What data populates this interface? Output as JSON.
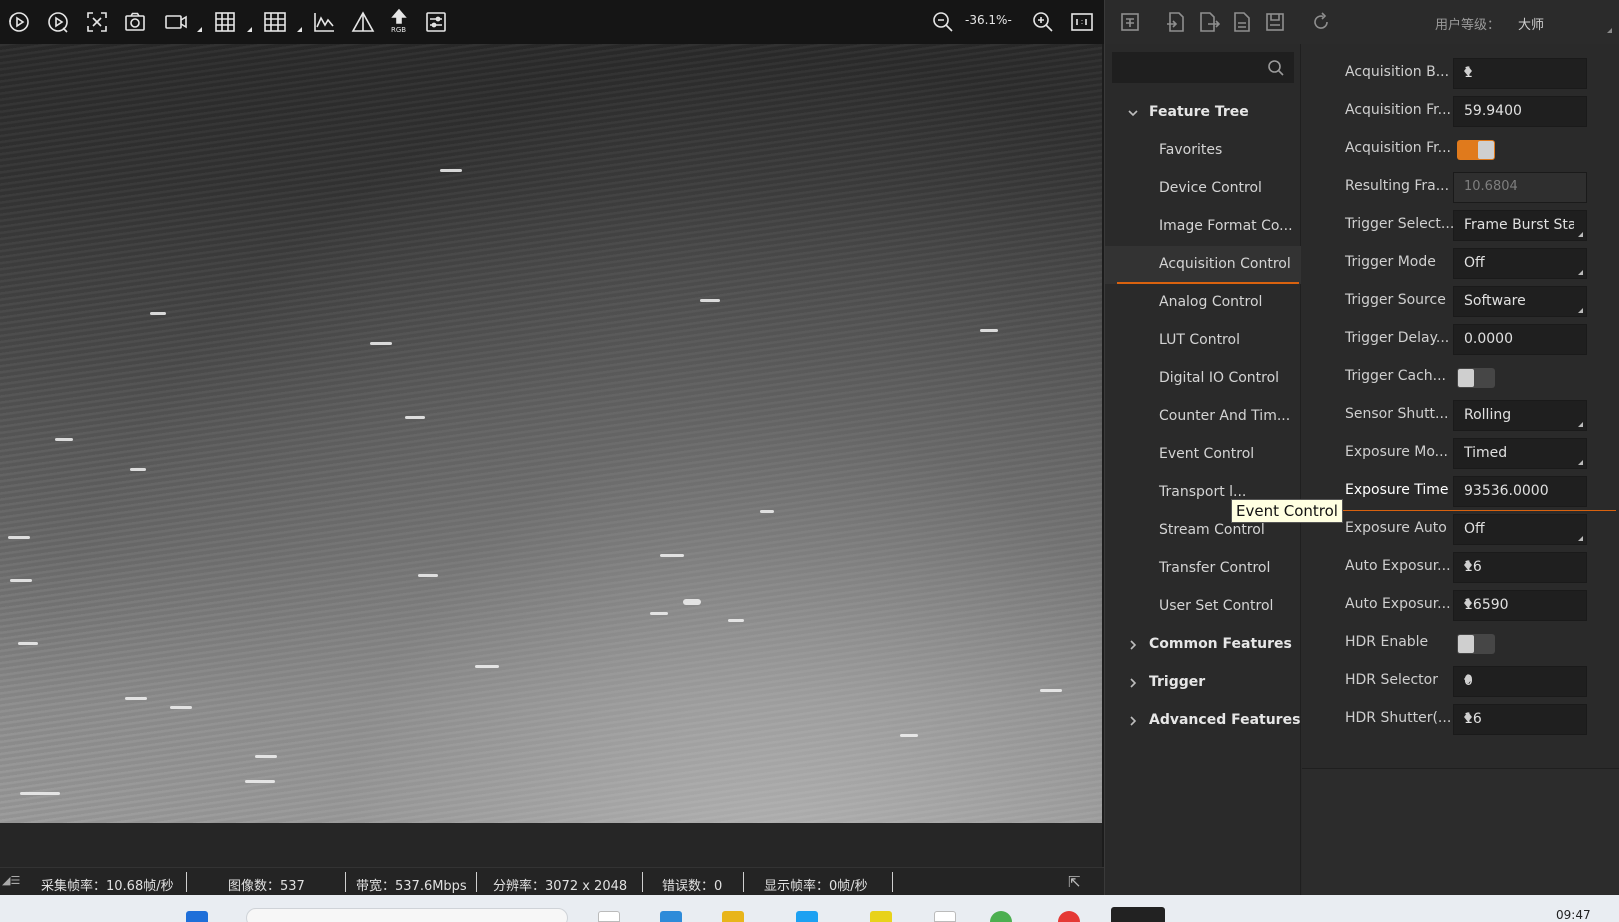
{
  "viewer": {
    "zoom_level": "-36.1%-",
    "rgb_label": "RGB",
    "toolbar_icons": [
      "continuous-capture-icon",
      "single-capture-icon",
      "stop-capture-icon",
      "snapshot-icon",
      "record-icon",
      "grid-layout-icon",
      "grid-icon",
      "histogram-icon",
      "warning-icon",
      "rgb-icon",
      "settings-icon",
      "zoom-out-icon",
      "zoom-in-icon",
      "actual-size-icon"
    ]
  },
  "statusbar": {
    "acq_rate": "采集帧率：10.68帧/秒",
    "image_count": "图像数：537",
    "bandwidth": "带宽：537.6Mbps",
    "resolution": "分辨率：3072 x 2048",
    "errors": "错误数：0",
    "display_rate": "显示帧率：0帧/秒"
  },
  "right_toolbar": {
    "user_level_label": "用户等级：",
    "user_level_value": "大师"
  },
  "tree": {
    "search_placeholder": "",
    "items": [
      {
        "label": "Feature Tree",
        "level": "top",
        "expanded": true
      },
      {
        "label": "Favorites",
        "level": "child"
      },
      {
        "label": "Device Control",
        "level": "child"
      },
      {
        "label": "Image Format Co...",
        "level": "child"
      },
      {
        "label": "Acquisition Control",
        "level": "child",
        "selected": true
      },
      {
        "label": "Analog Control",
        "level": "child"
      },
      {
        "label": "LUT Control",
        "level": "child"
      },
      {
        "label": "Digital IO Control",
        "level": "child"
      },
      {
        "label": "Counter And Tim...",
        "level": "child"
      },
      {
        "label": "Event Control",
        "level": "child"
      },
      {
        "label": "Transport l...",
        "level": "child"
      },
      {
        "label": "Stream Control",
        "level": "child"
      },
      {
        "label": "Transfer Control",
        "level": "child"
      },
      {
        "label": "User Set Control",
        "level": "child"
      },
      {
        "label": "Common Features",
        "level": "top",
        "expanded": false
      },
      {
        "label": "Trigger",
        "level": "top",
        "expanded": false
      },
      {
        "label": "Advanced Features",
        "level": "top",
        "expanded": false
      }
    ]
  },
  "properties": [
    {
      "label": "Acquisition B...",
      "type": "spin",
      "value": "1"
    },
    {
      "label": "Acquisition Fr...",
      "type": "text",
      "value": "59.9400"
    },
    {
      "label": "Acquisition Fr...",
      "type": "toggle",
      "on": true
    },
    {
      "label": "Resulting Fra...",
      "type": "readonly",
      "value": "10.6804"
    },
    {
      "label": "Trigger Select...",
      "type": "dropdown",
      "value": "Frame Burst Sta"
    },
    {
      "label": "Trigger Mode",
      "type": "dropdown",
      "value": "Off"
    },
    {
      "label": "Trigger Source",
      "type": "dropdown",
      "value": "Software"
    },
    {
      "label": "Trigger Delay...",
      "type": "text",
      "value": "0.0000"
    },
    {
      "label": "Trigger Cach...",
      "type": "toggle",
      "on": false
    },
    {
      "label": "Sensor Shutt...",
      "type": "dropdown",
      "value": "Rolling"
    },
    {
      "label": "Exposure Mo...",
      "type": "dropdown",
      "value": "Timed"
    },
    {
      "label": "Exposure Time",
      "type": "text",
      "value": "93536.0000",
      "active": true
    },
    {
      "label": "Exposure Auto",
      "type": "dropdown",
      "value": "Off"
    },
    {
      "label": "Auto Exposur...",
      "type": "spin",
      "value": "16"
    },
    {
      "label": "Auto Exposur...",
      "type": "spin",
      "value": "16590"
    },
    {
      "label": "HDR Enable",
      "type": "toggle",
      "on": false
    },
    {
      "label": "HDR Selector",
      "type": "spin",
      "value": "0"
    },
    {
      "label": "HDR Shutter(...",
      "type": "spin",
      "value": "16"
    }
  ],
  "tooltip": "Event Control",
  "taskbar": {
    "clock": "09:47"
  },
  "colors": {
    "accent": "#d9620f",
    "toggle_on": "#e07a1c"
  }
}
